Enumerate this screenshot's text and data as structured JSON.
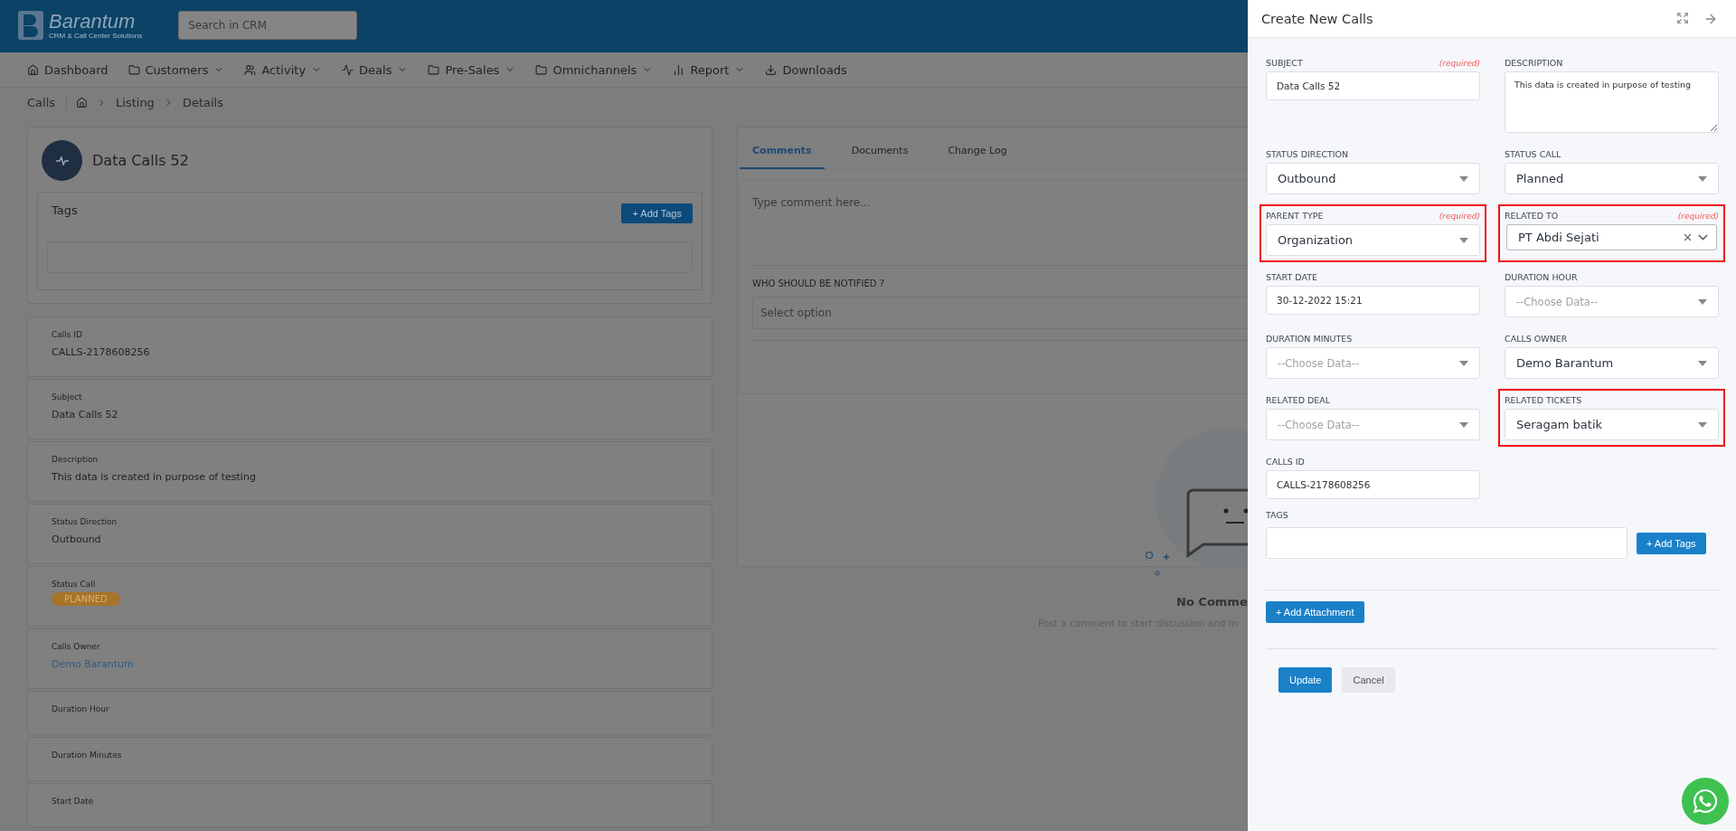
{
  "header": {
    "logo_name": "Barantum",
    "logo_tagline": "CRM & Call Center Solutions",
    "search_placeholder": "Search in CRM"
  },
  "nav": [
    {
      "label": "Dashboard",
      "dropdown": false
    },
    {
      "label": "Customers",
      "dropdown": true
    },
    {
      "label": "Activity",
      "dropdown": true
    },
    {
      "label": "Deals",
      "dropdown": true
    },
    {
      "label": "Pre-Sales",
      "dropdown": true
    },
    {
      "label": "Omnichannels",
      "dropdown": true
    },
    {
      "label": "Report",
      "dropdown": true
    },
    {
      "label": "Downloads",
      "dropdown": false
    }
  ],
  "breadcrumb": {
    "title": "Calls",
    "items": [
      "Listing",
      "Details"
    ]
  },
  "record": {
    "title": "Data Calls 52",
    "tags_label": "Tags",
    "add_tags": "+ Add Tags"
  },
  "details": [
    {
      "label": "Calls ID",
      "value": "CALLS-2178608256",
      "kind": "text"
    },
    {
      "label": "Subject",
      "value": "Data Calls 52",
      "kind": "text"
    },
    {
      "label": "Description",
      "value": "This data is created in purpose of testing",
      "kind": "text"
    },
    {
      "label": "Status Direction",
      "value": "Outbound",
      "kind": "text"
    },
    {
      "label": "Status Call",
      "value": "PLANNED",
      "kind": "badge"
    },
    {
      "label": "Calls Owner",
      "value": "Demo Barantum",
      "kind": "link"
    },
    {
      "label": "Duration Hour",
      "kind": "empty"
    },
    {
      "label": "Duration Minutes",
      "kind": "empty"
    },
    {
      "label": "Start Date",
      "kind": "empty"
    }
  ],
  "comments": {
    "tabs": [
      {
        "label": "Comments",
        "selected": true
      },
      {
        "label": "Documents",
        "selected": false
      },
      {
        "label": "Change Log",
        "selected": false
      }
    ],
    "placeholder": "Type comment here...",
    "notify_label": "WHO SHOULD BE NOTIFIED ?",
    "notify_placeholder": "Select option",
    "empty_title": "No Comme",
    "empty_text": "Post a comment to start discussion and m"
  },
  "drawer": {
    "title": "Create New Calls",
    "fields": [
      {
        "label": "SUBJECT",
        "required": "(required)",
        "kind": "text",
        "value": "Data Calls 52",
        "highlighted": false
      },
      {
        "label": "DESCRIPTION",
        "kind": "textarea",
        "value": "This data is created in purpose of testing",
        "highlighted": false
      },
      {
        "label": "STATUS DIRECTION",
        "kind": "select",
        "value": "Outbound",
        "highlighted": false
      },
      {
        "label": "STATUS CALL",
        "kind": "select",
        "value": "Planned",
        "highlighted": false
      },
      {
        "label": "PARENT TYPE",
        "required": "(required)",
        "kind": "select",
        "value": "Organization",
        "highlighted": true
      },
      {
        "label": "RELATED TO",
        "required": "(required)",
        "kind": "select-clearable",
        "value": "PT Abdi Sejati",
        "highlighted": true
      },
      {
        "label": "START DATE",
        "kind": "text",
        "value": "30-12-2022 15:21",
        "highlighted": false
      },
      {
        "label": "DURATION HOUR",
        "kind": "select",
        "placeholder": "--Choose Data--",
        "highlighted": false
      },
      {
        "label": "DURATION MINUTES",
        "kind": "select",
        "placeholder": "--Choose Data--",
        "highlighted": false
      },
      {
        "label": "CALLS OWNER",
        "kind": "select",
        "value": "Demo Barantum",
        "highlighted": false
      },
      {
        "label": "RELATED DEAL",
        "kind": "select",
        "placeholder": "--Choose Data--",
        "highlighted": false
      },
      {
        "label": "RELATED TICKETS",
        "kind": "select",
        "value": "Seragam batik",
        "highlighted": true
      },
      {
        "label": "CALLS ID",
        "kind": "text",
        "value": "CALLS-2178608256",
        "highlighted": false
      }
    ],
    "tags_label": "TAGS",
    "add_tags": "+ Add Tags",
    "add_attachment": "+ Add Attachment",
    "buttons": [
      {
        "label": "Update",
        "kind": "primary"
      },
      {
        "label": "Cancel",
        "kind": "secondary"
      }
    ]
  }
}
